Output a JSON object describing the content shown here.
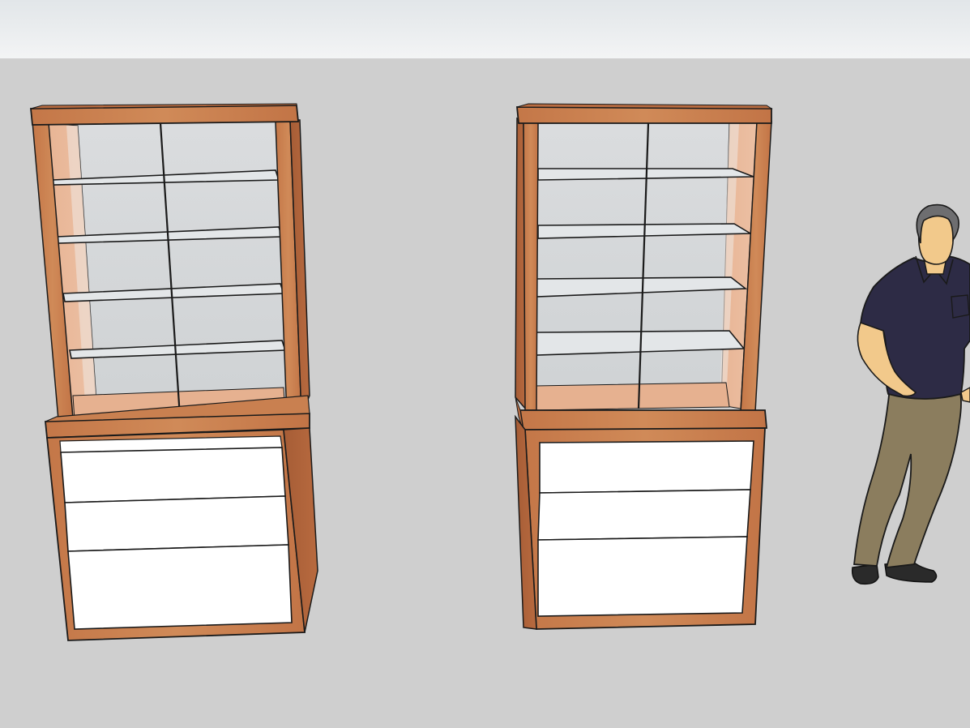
{
  "scene": {
    "sky_color": "#eceef0",
    "ground_color": "#cfcfcf",
    "wood_color": "#c9804f",
    "wood_dark_color": "#a8623a",
    "glass_color": "#d6d9db",
    "drawer_color": "#ffffff",
    "interior_color": "#e5ae8f",
    "edge_color": "#1a1a1a",
    "objects": [
      {
        "name": "display-cabinet-left",
        "shelves": 4,
        "drawers": 3
      },
      {
        "name": "display-cabinet-right",
        "shelves": 4,
        "drawers": 3
      },
      {
        "name": "scale-figure-person",
        "icon": "person-icon"
      }
    ]
  }
}
